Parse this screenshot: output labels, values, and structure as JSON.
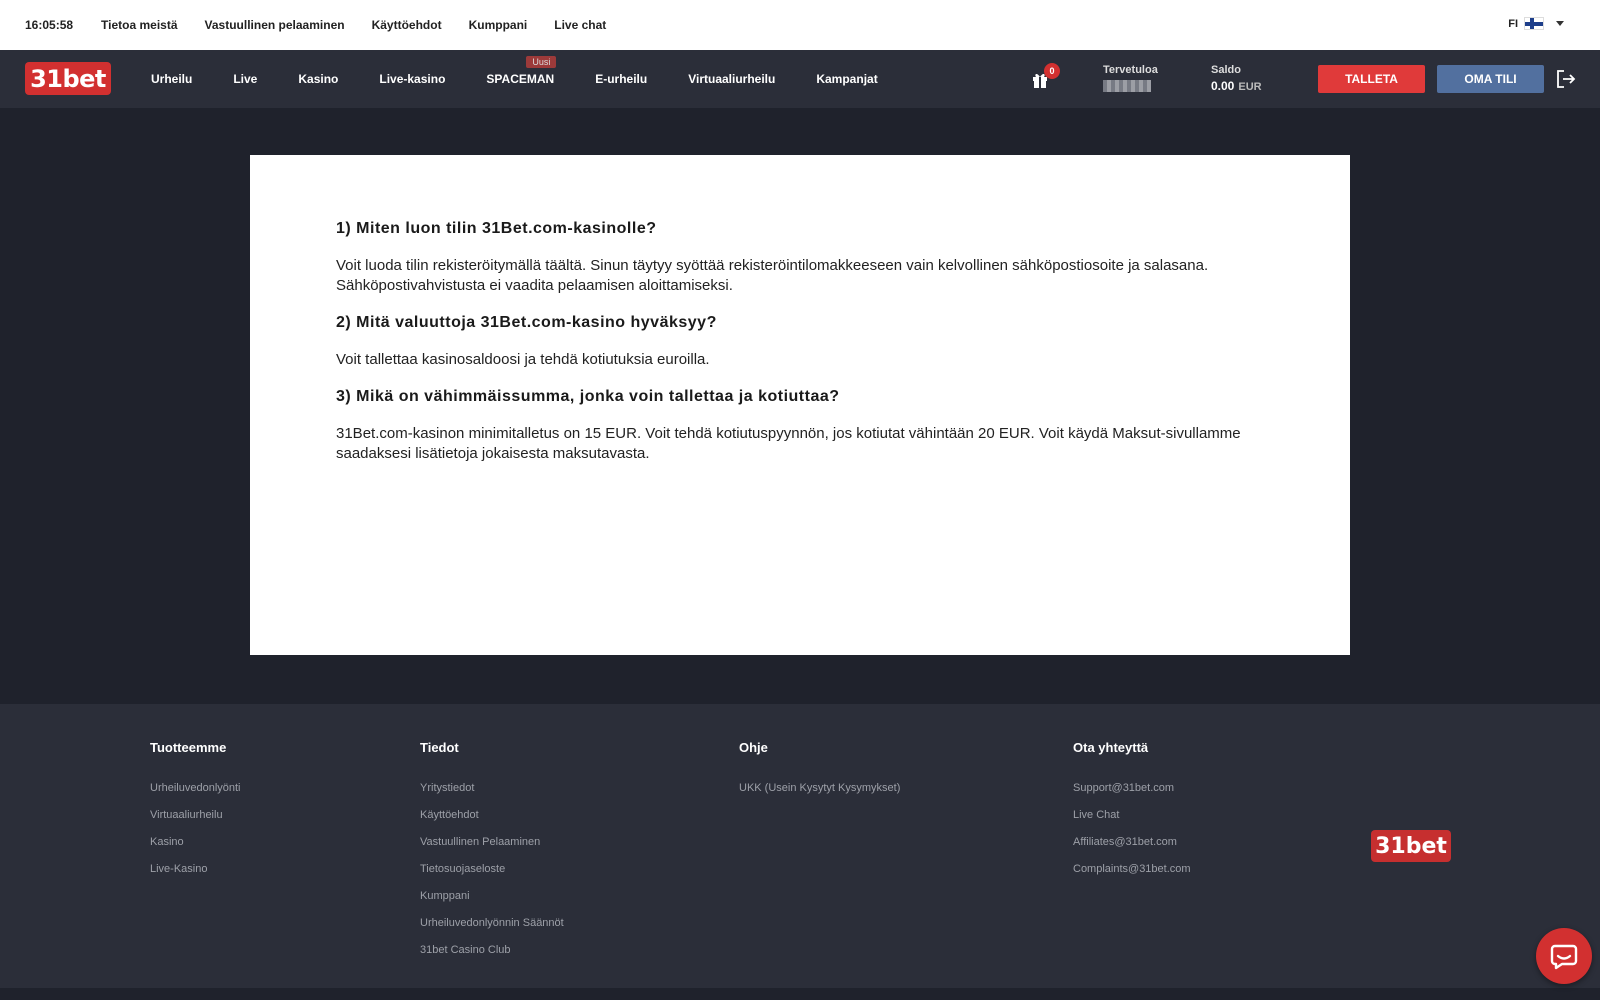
{
  "topbar": {
    "clock": "16:05:58",
    "links": [
      "Tietoa meistä",
      "Vastuullinen pelaaminen",
      "Käyttöehdot",
      "Kumppani",
      "Live chat"
    ],
    "language": "FI"
  },
  "nav": {
    "logo": "31bet",
    "items": [
      "Urheilu",
      "Live",
      "Kasino",
      "Live-kasino",
      "SPACEMAN",
      "E-urheilu",
      "Virtuaaliurheilu",
      "Kampanjat"
    ],
    "new_badge": "Uusi",
    "gift_count": "0",
    "welcome_label": "Tervetuloa",
    "balance_label": "Saldo",
    "balance_value": "0.00",
    "balance_currency": "EUR",
    "deposit_button": "TALLETA",
    "account_button": "OMA TILI"
  },
  "faq": [
    {
      "question": "1) Miten luon tilin 31Bet.com-kasinolle?",
      "answer": "Voit luoda tilin rekisteröitymällä täältä. Sinun täytyy syöttää rekisteröintilomakkeeseen vain kelvollinen sähköpostiosoite ja salasana. Sähköpostivahvistusta ei vaadita pelaamisen aloittamiseksi."
    },
    {
      "question": "2) Mitä valuuttoja 31Bet.com-kasino hyväksyy?",
      "answer": "Voit tallettaa kasinosaldoosi ja tehdä kotiutuksia euroilla."
    },
    {
      "question": "3) Mikä on vähimmäissumma, jonka voin tallettaa ja kotiuttaa?",
      "answer": "31Bet.com-kasinon minimitalletus on 15 EUR. Voit tehdä kotiutuspyynnön, jos kotiutat vähintään 20 EUR. Voit käydä Maksut-sivullamme saadaksesi lisätietoja jokaisesta maksutavasta."
    }
  ],
  "footer": {
    "columns": [
      {
        "title": "Tuotteemme",
        "links": [
          "Urheiluvedonlyönti",
          "Virtuaaliurheilu",
          "Kasino",
          "Live-Kasino"
        ]
      },
      {
        "title": "Tiedot",
        "links": [
          "Yritystiedot",
          "Käyttöehdot",
          "Vastuullinen Pelaaminen",
          "Tietosuojaseloste",
          "Kumppani",
          "Urheiluvedonlyönnin Säännöt",
          "31bet Casino Club"
        ]
      },
      {
        "title": "Ohje",
        "links": [
          "UKK (Usein Kysytyt Kysymykset)"
        ]
      },
      {
        "title": "Ota yhteyttä",
        "links": [
          "Support@31bet.com",
          "Live Chat",
          "Affiliates@31bet.com",
          "Complaints@31bet.com"
        ]
      }
    ],
    "logo": "31bet"
  },
  "colors": {
    "brand_red": "#d23030",
    "nav_bg": "#2b2e39",
    "page_bg": "#1f222c",
    "account_blue": "#52709f"
  },
  "icons": [
    "flag-fi-icon",
    "chevron-down-icon",
    "gift-icon",
    "logout-icon",
    "chat-icon"
  ]
}
